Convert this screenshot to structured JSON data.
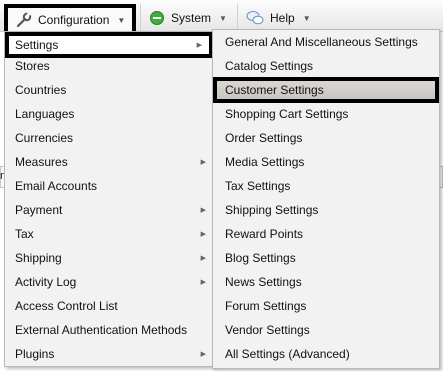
{
  "menubar": {
    "items": [
      {
        "label": "Configuration",
        "icon": "wrench-icon"
      },
      {
        "label": "System",
        "icon": "green-circle-icon"
      },
      {
        "label": "Help",
        "icon": "chat-bubbles-icon"
      }
    ]
  },
  "background": {
    "fragment_left": "n",
    "fragment_right": ""
  },
  "config_menu": {
    "items": [
      {
        "label": "Settings",
        "has_submenu": true
      },
      {
        "label": "Stores",
        "has_submenu": false
      },
      {
        "label": "Countries",
        "has_submenu": false
      },
      {
        "label": "Languages",
        "has_submenu": false
      },
      {
        "label": "Currencies",
        "has_submenu": false
      },
      {
        "label": "Measures",
        "has_submenu": true
      },
      {
        "label": "Email Accounts",
        "has_submenu": false
      },
      {
        "label": "Payment",
        "has_submenu": true
      },
      {
        "label": "Tax",
        "has_submenu": true
      },
      {
        "label": "Shipping",
        "has_submenu": true
      },
      {
        "label": "Activity Log",
        "has_submenu": true
      },
      {
        "label": "Access Control List",
        "has_submenu": false
      },
      {
        "label": "External Authentication Methods",
        "has_submenu": false
      },
      {
        "label": "Plugins",
        "has_submenu": true
      }
    ]
  },
  "settings_menu": {
    "items": [
      "General And Miscellaneous Settings",
      "Catalog Settings",
      "Customer Settings",
      "Shopping Cart Settings",
      "Order Settings",
      "Media Settings",
      "Tax Settings",
      "Shipping Settings",
      "Reward Points",
      "Blog Settings",
      "News Settings",
      "Forum Settings",
      "Vendor Settings",
      "All Settings (Advanced)"
    ]
  },
  "colors": {
    "highlight_border": "#000000",
    "hover_item": "#cdcac6",
    "menu_bg": "#f2f2f2",
    "system_icon": "#3fae3f"
  }
}
